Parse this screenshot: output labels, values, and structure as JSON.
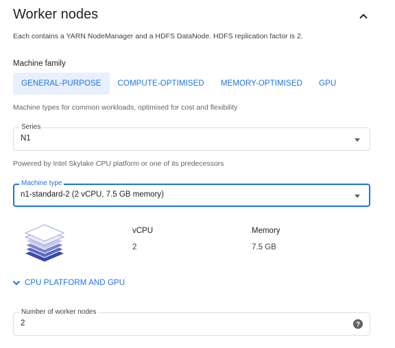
{
  "header": {
    "title": "Worker nodes",
    "collapse_icon": "chevron-up-icon"
  },
  "description": "Each contains a YARN NodeManager and a HDFS DataNode. HDFS replication factor is 2.",
  "machine_family": {
    "label": "Machine family",
    "tabs": [
      {
        "label": "GENERAL-PURPOSE",
        "active": true
      },
      {
        "label": "COMPUTE-OPTIMISED",
        "active": false
      },
      {
        "label": "MEMORY-OPTIMISED",
        "active": false
      },
      {
        "label": "GPU",
        "active": false
      }
    ],
    "helper": "Machine types for common workloads, optimised for cost and flexibility"
  },
  "series": {
    "label": "Series",
    "value": "N1",
    "helper": "Powered by Intel Skylake CPU platform or one of its predecessors"
  },
  "machine_type": {
    "label": "Machine type",
    "value": "n1-standard-2 (2 vCPU, 7.5 GB memory)"
  },
  "specs": {
    "icon": "layers-icon",
    "vcpu_label": "vCPU",
    "vcpu_value": "2",
    "memory_label": "Memory",
    "memory_value": "7.5 GB"
  },
  "cpu_platform": {
    "label": "CPU PLATFORM AND GPU",
    "icon": "chevron-down-icon"
  },
  "worker_count": {
    "label": "Number of worker nodes",
    "value": "2",
    "help_icon": "help-icon"
  },
  "colors": {
    "accent": "#1a73e8",
    "active_tab_bg": "#e8f0fe",
    "border": "#dadce0",
    "layers": "#3f51b5"
  }
}
